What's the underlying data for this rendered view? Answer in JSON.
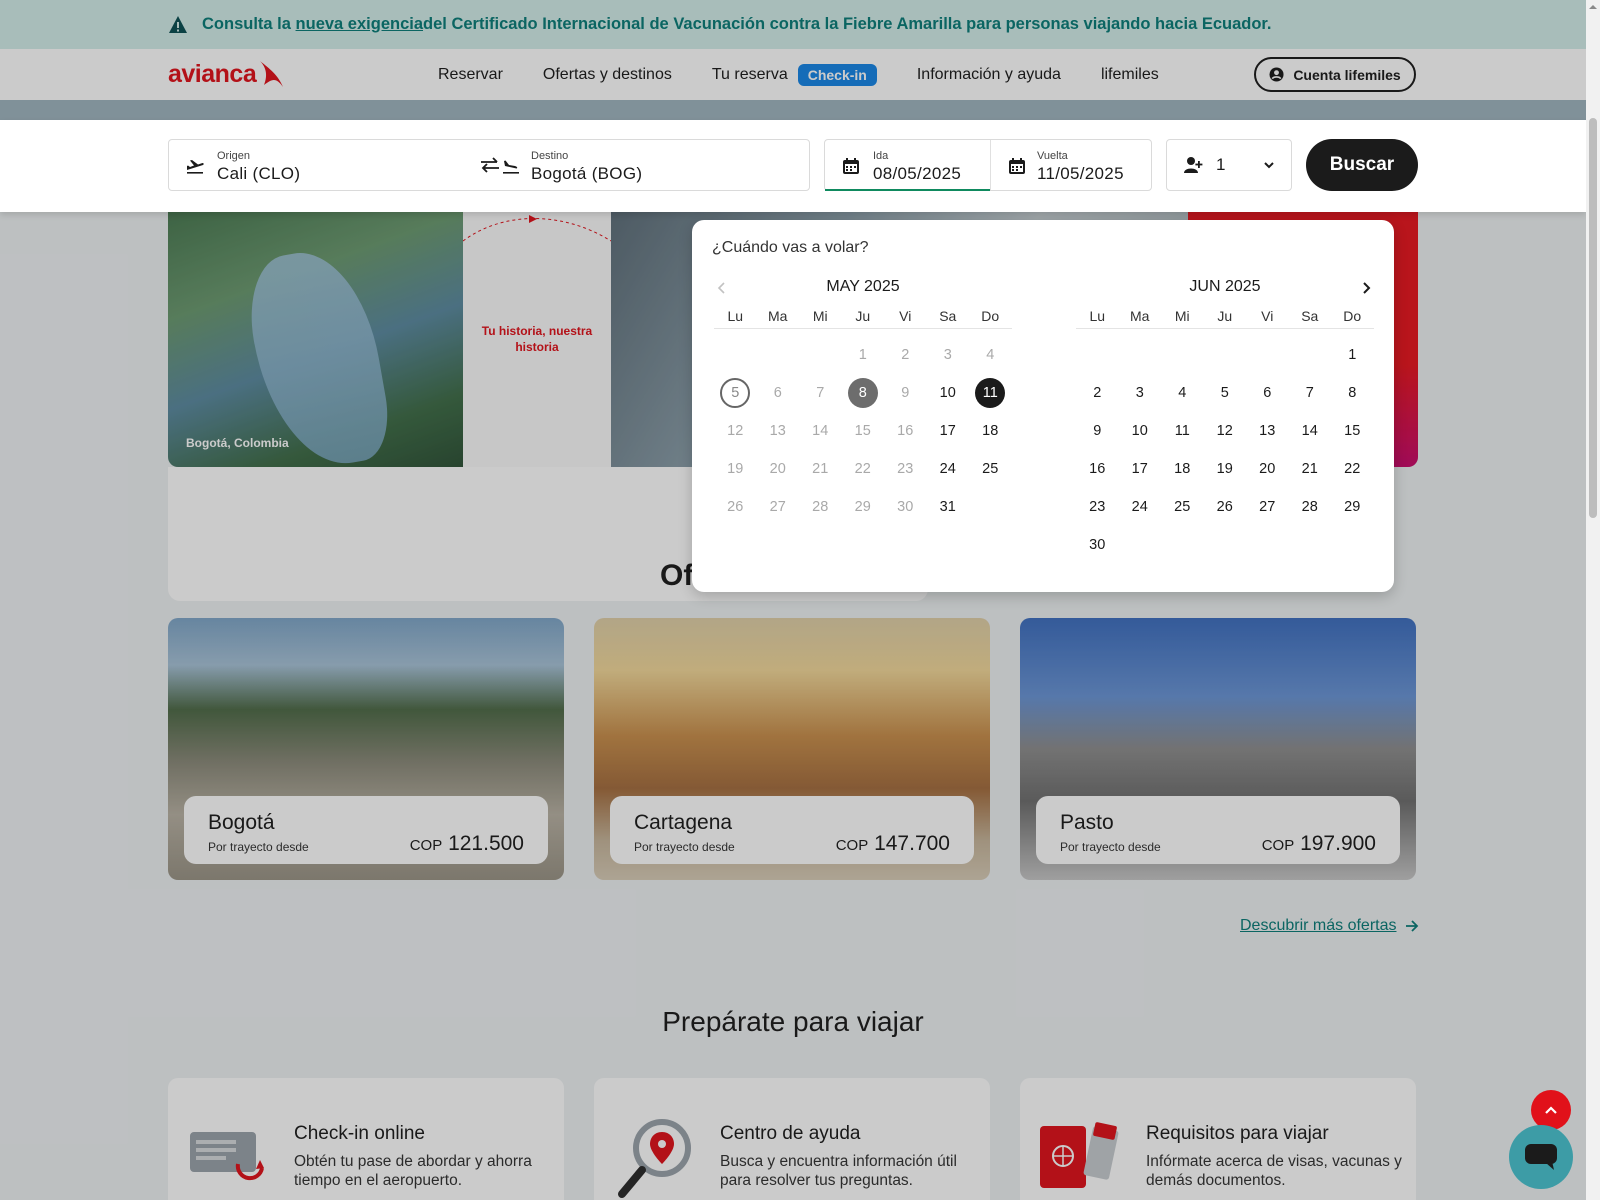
{
  "banner": {
    "text_before": "Consulta la ",
    "link": "nueva exigencia",
    "text_after": " del Certificado Internacional de Vacunación contra la Fiebre Amarilla para personas viajando hacia Ecuador."
  },
  "header": {
    "logo": "avianca",
    "nav": [
      "Reservar",
      "Ofertas y destinos",
      "Tu reserva",
      "Información y ayuda",
      "lifemiles"
    ],
    "checkin_badge": "Check-in",
    "account_button": "Cuenta lifemiles"
  },
  "search": {
    "origin_label": "Origen",
    "origin_value": "Cali (CLO)",
    "destination_label": "Destino",
    "destination_value": "Bogotá (BOG)",
    "departure_label": "Ida",
    "departure_value": "08/05/2025",
    "return_label": "Vuelta",
    "return_value": "11/05/2025",
    "passengers": "1",
    "search_button": "Buscar"
  },
  "hero": {
    "photo_caption": "Bogotá, Colombia",
    "tagline": "Tu historia, nuestra historia"
  },
  "offers": {
    "heading_partial": "Of",
    "cards": [
      {
        "city": "Bogotá",
        "subtitle": "Por trayecto desde",
        "currency": "COP",
        "price": "121.500"
      },
      {
        "city": "Cartagena",
        "subtitle": "Por trayecto desde",
        "currency": "COP",
        "price": "147.700"
      },
      {
        "city": "Pasto",
        "subtitle": "Por trayecto desde",
        "currency": "COP",
        "price": "197.900"
      }
    ],
    "more_link": "Descubrir más ofertas"
  },
  "prepare": {
    "title": "Prepárate para viajar",
    "cards": [
      {
        "title": "Check-in online",
        "desc": "Obtén tu pase de abordar y ahorra tiempo en el aeropuerto."
      },
      {
        "title": "Centro de ayuda",
        "desc": "Busca y encuentra información útil para resolver tus preguntas."
      },
      {
        "title": "Requisitos para viajar",
        "desc": "Infórmate acerca de visas, vacunas y demás documentos."
      }
    ]
  },
  "calendar": {
    "question": "¿Cuándo vas a volar?",
    "weekdays": [
      "Lu",
      "Ma",
      "Mi",
      "Ju",
      "Vi",
      "Sa",
      "Do"
    ],
    "months": [
      {
        "title": "MAY 2025",
        "lead_blanks": 3,
        "days": [
          {
            "d": "1",
            "s": "dis"
          },
          {
            "d": "2",
            "s": "dis"
          },
          {
            "d": "3",
            "s": "dis"
          },
          {
            "d": "4",
            "s": "dis"
          },
          {
            "d": "5",
            "s": "dis today"
          },
          {
            "d": "6",
            "s": "dis"
          },
          {
            "d": "7",
            "s": "dis"
          },
          {
            "d": "8",
            "s": "sel-start"
          },
          {
            "d": "9",
            "s": "dis"
          },
          {
            "d": "10",
            "s": ""
          },
          {
            "d": "11",
            "s": "sel-end"
          },
          {
            "d": "12",
            "s": "dis"
          },
          {
            "d": "13",
            "s": "dis"
          },
          {
            "d": "14",
            "s": "dis"
          },
          {
            "d": "15",
            "s": "dis"
          },
          {
            "d": "16",
            "s": "dis"
          },
          {
            "d": "17",
            "s": ""
          },
          {
            "d": "18",
            "s": ""
          },
          {
            "d": "19",
            "s": "dis"
          },
          {
            "d": "20",
            "s": "dis"
          },
          {
            "d": "21",
            "s": "dis"
          },
          {
            "d": "22",
            "s": "dis"
          },
          {
            "d": "23",
            "s": "dis"
          },
          {
            "d": "24",
            "s": ""
          },
          {
            "d": "25",
            "s": ""
          },
          {
            "d": "26",
            "s": "dis"
          },
          {
            "d": "27",
            "s": "dis"
          },
          {
            "d": "28",
            "s": "dis"
          },
          {
            "d": "29",
            "s": "dis"
          },
          {
            "d": "30",
            "s": "dis"
          },
          {
            "d": "31",
            "s": ""
          }
        ]
      },
      {
        "title": "JUN 2025",
        "lead_blanks": 6,
        "days": [
          {
            "d": "1",
            "s": ""
          },
          {
            "d": "2",
            "s": ""
          },
          {
            "d": "3",
            "s": ""
          },
          {
            "d": "4",
            "s": ""
          },
          {
            "d": "5",
            "s": ""
          },
          {
            "d": "6",
            "s": ""
          },
          {
            "d": "7",
            "s": ""
          },
          {
            "d": "8",
            "s": ""
          },
          {
            "d": "9",
            "s": ""
          },
          {
            "d": "10",
            "s": ""
          },
          {
            "d": "11",
            "s": ""
          },
          {
            "d": "12",
            "s": ""
          },
          {
            "d": "13",
            "s": ""
          },
          {
            "d": "14",
            "s": ""
          },
          {
            "d": "15",
            "s": ""
          },
          {
            "d": "16",
            "s": ""
          },
          {
            "d": "17",
            "s": ""
          },
          {
            "d": "18",
            "s": ""
          },
          {
            "d": "19",
            "s": ""
          },
          {
            "d": "20",
            "s": ""
          },
          {
            "d": "21",
            "s": ""
          },
          {
            "d": "22",
            "s": ""
          },
          {
            "d": "23",
            "s": ""
          },
          {
            "d": "24",
            "s": ""
          },
          {
            "d": "25",
            "s": ""
          },
          {
            "d": "26",
            "s": ""
          },
          {
            "d": "27",
            "s": ""
          },
          {
            "d": "28",
            "s": ""
          },
          {
            "d": "29",
            "s": ""
          },
          {
            "d": "30",
            "s": ""
          }
        ]
      }
    ]
  },
  "colors": {
    "brand_red": "#e1111a",
    "teal": "#0a7d79",
    "checkin_blue": "#1686e7",
    "selected_dark": "#1b1b1b"
  },
  "icons": [
    "warning-icon",
    "avianca-bird-icon",
    "user-circle-icon",
    "takeoff-icon",
    "swap-icon",
    "landing-icon",
    "calendar-icon",
    "add-user-icon",
    "chevron-down-icon",
    "chevron-left-icon",
    "chevron-right-icon",
    "arrow-right-icon",
    "chevron-up-icon",
    "chat-icon"
  ]
}
